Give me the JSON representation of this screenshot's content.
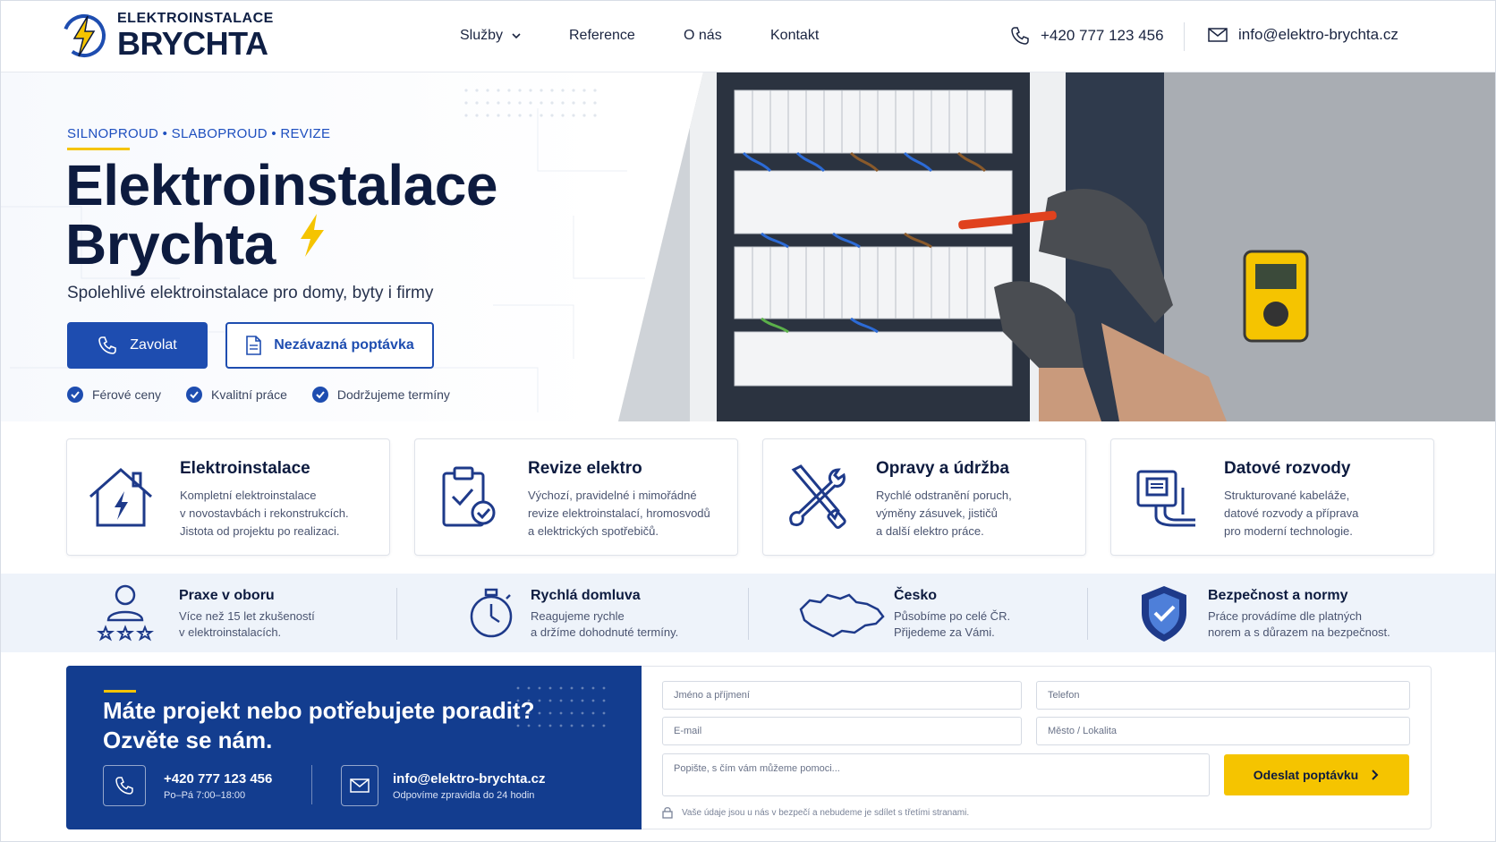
{
  "brand": {
    "top": "ELEKTROINSTALACE",
    "bottom": "BRYCHTA",
    "accent_color": "#f5c400",
    "primary_color": "#1e4db0",
    "dark_color": "#0d1b3f"
  },
  "nav": {
    "items": [
      {
        "label": "Služby",
        "icon": "chevron-down-icon"
      },
      {
        "label": "Reference"
      },
      {
        "label": "O nás"
      },
      {
        "label": "Kontakt"
      }
    ]
  },
  "header_contact": {
    "phone": "+420 777 123 456",
    "email": "info@elektro-brychta.cz"
  },
  "hero": {
    "kicker": "SILNOPROUD • SLABOPROUD • REVIZE",
    "title_line1": "Elektroinstalace",
    "title_line2": "Brychta",
    "subtitle": "Spolehlivé elektroinstalace pro domy, byty i firmy",
    "btn_call": "Zavolat",
    "btn_quote": "Nezávazná poptávka",
    "checks": [
      "Férové ceny",
      "Kvalitní práce",
      "Dodržujeme termíny"
    ]
  },
  "services": [
    {
      "title": "Elektroinstalace",
      "icon": "house-bolt-icon",
      "lines": [
        "Kompletní elektroinstalace",
        "v novostavbách i rekonstrukcích.",
        "Jistota od projektu po realizaci."
      ]
    },
    {
      "title": "Revize elektro",
      "icon": "clipboard-check-icon",
      "lines": [
        "Výchozí, pravidelné i mimořádné",
        "revize elektroinstalací, hromosvodů",
        "a elektrických spotřebičů."
      ]
    },
    {
      "title": "Opravy a údržba",
      "icon": "tools-icon",
      "lines": [
        "Rychlé odstranění poruch,",
        "výměny zásuvek, jističů",
        "a další elektro práce."
      ]
    },
    {
      "title": "Datové rozvody",
      "icon": "network-socket-icon",
      "lines": [
        "Strukturované kabeláže,",
        "datové rozvody a příprava",
        "pro moderní technologie."
      ]
    }
  ],
  "features": [
    {
      "title": "Praxe v oboru",
      "icon": "person-stars-icon",
      "lines": [
        "Více než 15 let zkušeností",
        "v elektroinstalacích."
      ]
    },
    {
      "title": "Rychlá domluva",
      "icon": "stopwatch-icon",
      "lines": [
        "Reagujeme rychle",
        "a držíme dohodnuté termíny."
      ]
    },
    {
      "title": "Česko",
      "icon": "czech-map-icon",
      "lines": [
        "Působíme po celé ČR.",
        "Přijedeme za Vámi."
      ]
    },
    {
      "title": "Bezpečnost a normy",
      "icon": "shield-check-icon",
      "lines": [
        "Práce provádíme dle platných",
        "norem a s důrazem na bezpečnost."
      ]
    }
  ],
  "cta": {
    "title_line1": "Máte projekt nebo potřebujete poradit?",
    "title_line2": "Ozvěte se nám.",
    "phone": "+420 777 123 456",
    "phone_hours": "Po–Pá 7:00–18:00",
    "email": "info@elektro-brychta.cz",
    "email_note": "Odpovíme zpravidla do 24 hodin"
  },
  "form": {
    "name_placeholder": "Jméno a příjmení",
    "phone_placeholder": "Telefon",
    "email_placeholder": "E-mail",
    "city_placeholder": "Město / Lokalita",
    "message_placeholder": "Popište, s čím vám můžeme pomoci...",
    "submit_label": "Odeslat poptávku",
    "privacy_note": "Vaše údaje jsou u nás v bezpečí a nebudeme je sdílet s třetími stranami."
  }
}
